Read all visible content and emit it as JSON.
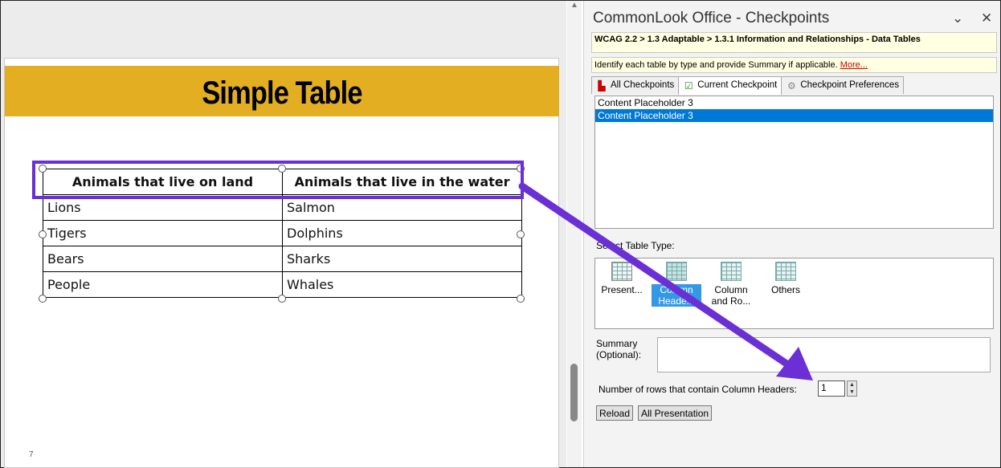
{
  "slide": {
    "title": "Simple Table",
    "number": "7",
    "table": {
      "headers": [
        "Animals that live on land",
        "Animals that live in the water"
      ],
      "rows": [
        [
          "Lions",
          "Salmon"
        ],
        [
          "Tigers",
          "Dolphins"
        ],
        [
          "Bears",
          "Sharks"
        ],
        [
          "People",
          "Whales"
        ]
      ]
    }
  },
  "pane": {
    "title": "CommonLook Office - Checkpoints",
    "collapse_icon": "chevron-down-icon",
    "close_icon": "close-icon",
    "breadcrumb": "WCAG 2.2 > 1.3 Adaptable > 1.3.1 Information and Relationships - Data Tables",
    "hint": "Identify each table by type and provide Summary if applicable.",
    "hint_link": "More...",
    "tabs": [
      {
        "label": "All Checkpoints",
        "icon": "checkpoints-icon"
      },
      {
        "label": "Current Checkpoint",
        "icon": "checkmark-icon"
      },
      {
        "label": "Checkpoint Preferences",
        "icon": "gear-icon"
      }
    ],
    "placeholders": [
      "Content Placeholder 3",
      "Content Placeholder 3"
    ],
    "select_table_type_label": "Select Table Type:",
    "table_types": [
      {
        "line1": "Present...",
        "line2": ""
      },
      {
        "line1": "Column",
        "line2": "Heade..."
      },
      {
        "line1": "Column",
        "line2": "and Ro..."
      },
      {
        "line1": "Others",
        "line2": ""
      }
    ],
    "selected_table_type": "Column Headers",
    "summary_label_1": "Summary",
    "summary_label_2": "(Optional):",
    "summary_value": "",
    "rows_label": "Number of rows that contain Column Headers:",
    "rows_value": "1",
    "reload_button": "Reload",
    "all_presentation_button": "All Presentation"
  },
  "colors": {
    "title_band": "#e3ae22",
    "highlight": "#6b2fd6",
    "selection": "#0078d7"
  }
}
